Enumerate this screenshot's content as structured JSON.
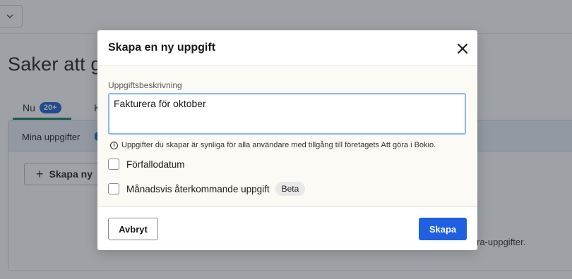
{
  "background": {
    "page_title": "Saker att g",
    "tabs": [
      {
        "label": "Nu",
        "badge": "20+"
      },
      {
        "label": "K"
      }
    ],
    "panel_label": "Mina uppgifter",
    "create_button_label": "Skapa ny",
    "hint_text": "ra-uppgifter."
  },
  "modal": {
    "title": "Skapa en ny uppgift",
    "field_label": "Uppgiftsbeskrivning",
    "field_value": "Fakturera för oktober",
    "info_text": "Uppgifter du skapar är synliga för alla användare med tillgång till företagets Att göra i Bokio.",
    "due_date_label": "Förfallodatum",
    "recurring_label": "Månadsvis återkommande uppgift",
    "beta_label": "Beta",
    "cancel_label": "Avbryt",
    "create_label": "Skapa"
  },
  "colors": {
    "primary": "#1f5fe0",
    "tab_active": "#1a7f5a",
    "focus_border": "#8bb8ef",
    "overlay": "rgba(40,46,56,0.45)"
  }
}
